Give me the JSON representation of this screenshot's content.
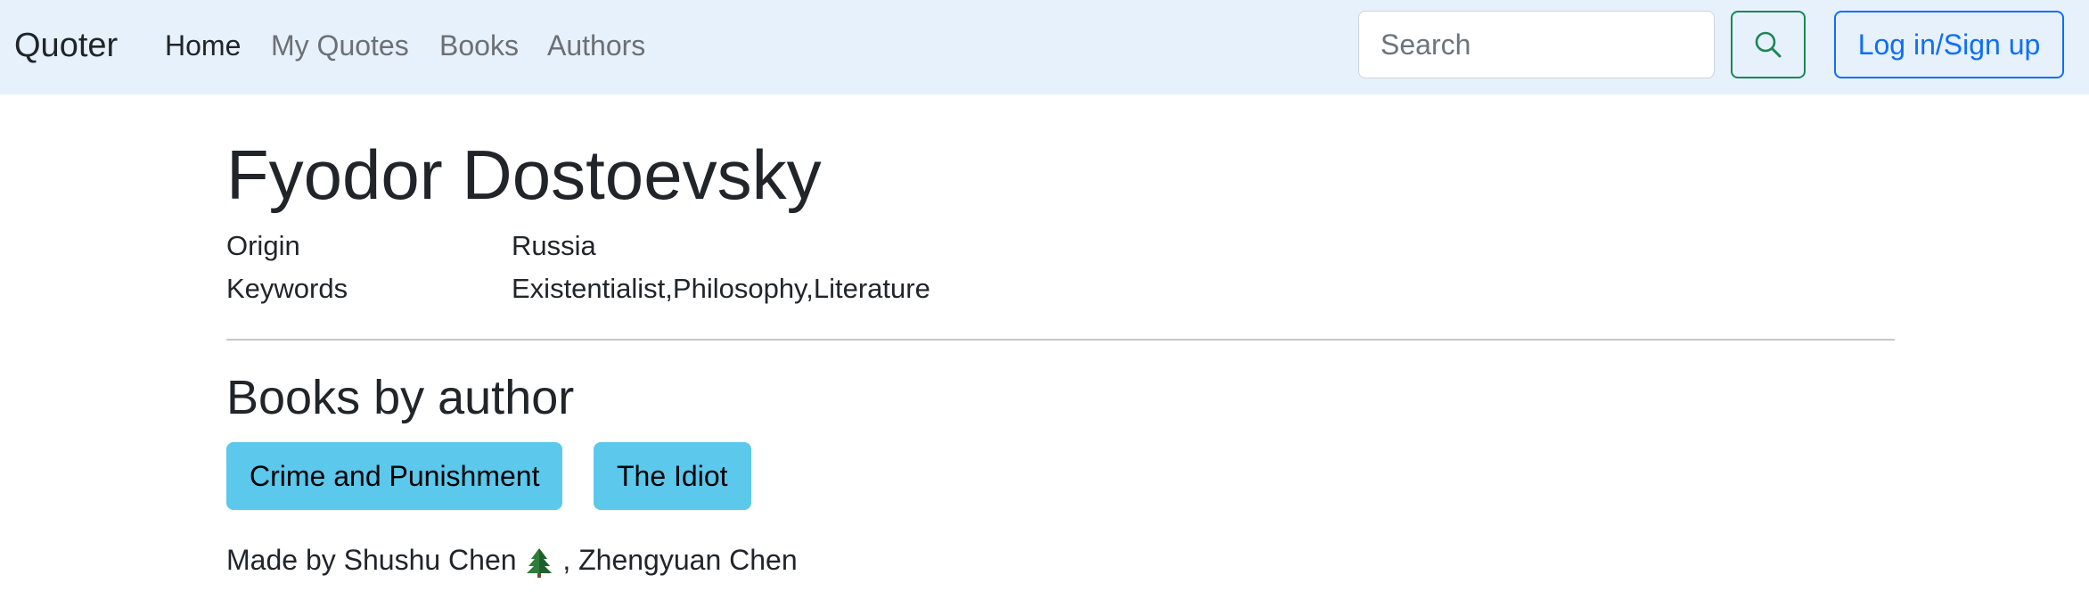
{
  "navbar": {
    "brand": "Quoter",
    "links": [
      {
        "label": "Home",
        "active": true
      },
      {
        "label": "My Quotes",
        "active": false
      },
      {
        "label": "Books",
        "active": false
      },
      {
        "label": "Authors",
        "active": false
      }
    ],
    "search": {
      "placeholder": "Search",
      "value": "",
      "icon": "search-icon"
    },
    "login_label": "Log in/Sign up"
  },
  "author": {
    "name": "Fyodor Dostoevsky",
    "origin_label": "Origin",
    "origin": "Russia",
    "keywords_label": "Keywords",
    "keywords": "Existentialist,Philosophy,Literature"
  },
  "books_section": {
    "title": "Books by author",
    "books": [
      "Crime and Punishment",
      "The Idiot"
    ]
  },
  "footer": {
    "prefix": "Made by Shushu Chen",
    "icon": "tree-icon",
    "suffix": ", Zhengyuan Chen"
  },
  "colors": {
    "navbar_bg": "#e7f1fb",
    "book_button": "#5bc8ec",
    "search_button_border": "#198754",
    "login_button": "#0d6efd"
  }
}
